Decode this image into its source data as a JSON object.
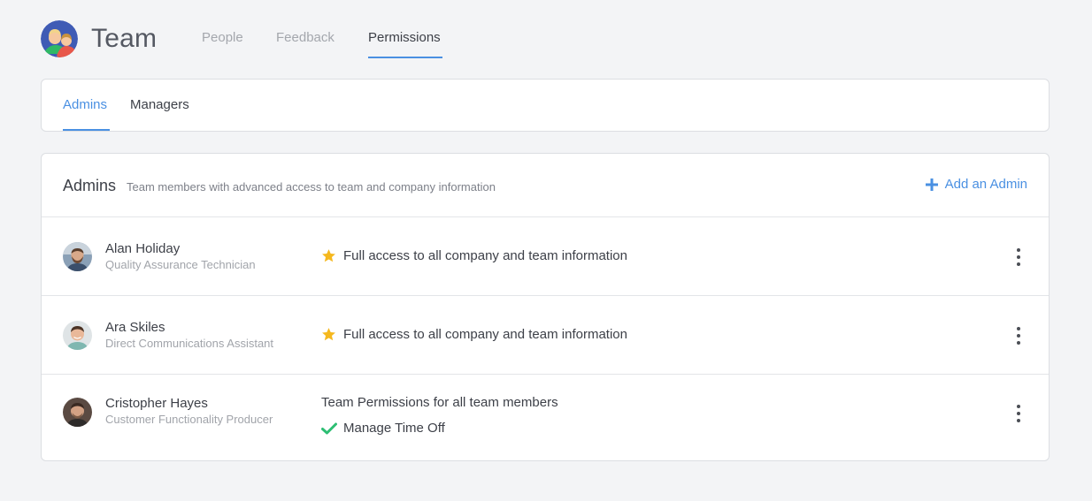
{
  "header": {
    "title": "Team",
    "tabs": [
      {
        "label": "People",
        "active": false
      },
      {
        "label": "Feedback",
        "active": false
      },
      {
        "label": "Permissions",
        "active": true
      }
    ]
  },
  "subtabs": [
    {
      "label": "Admins",
      "active": true
    },
    {
      "label": "Managers",
      "active": false
    }
  ],
  "admins_section": {
    "title": "Admins",
    "subtitle": "Team members with advanced access to team and company information",
    "add_label": "Add an Admin",
    "rows": [
      {
        "name": "Alan Holiday",
        "role": "Quality Assurance Technician",
        "access_icon": "star-icon",
        "access": "Full access to all company and team information"
      },
      {
        "name": "Ara Skiles",
        "role": "Direct Communications Assistant",
        "access_icon": "star-icon",
        "access": "Full access to all company and team information"
      },
      {
        "name": "Cristopher Hayes",
        "role": "Customer Functionality Producer",
        "permissions_title": "Team Permissions for all team members",
        "access_icon": "check-icon",
        "access": "Manage Time Off"
      }
    ]
  },
  "colors": {
    "accent": "#4a90e2",
    "star": "#f5b81e",
    "check": "#2dbe73",
    "background": "#f3f4f6"
  }
}
